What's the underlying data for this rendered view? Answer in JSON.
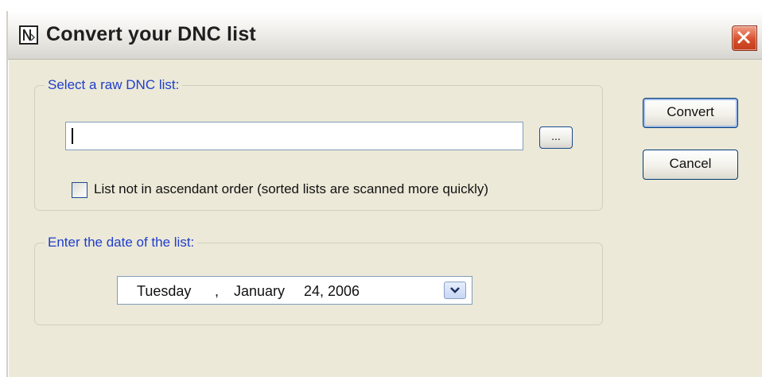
{
  "window": {
    "title": "Convert your DNC list",
    "icon": "dnc-file-icon",
    "close_icon": "close-icon"
  },
  "source_group": {
    "legend": "Select a raw DNC list:",
    "path_value": "",
    "browse_label": "...",
    "checkbox_checked": false,
    "checkbox_label": "List not in ascendant order (sorted lists are scanned more quickly)"
  },
  "date_group": {
    "legend": "Enter the date of the list:",
    "day_of_week": "Tuesday",
    "separator": ",",
    "month": "January",
    "date_year": "24, 2006",
    "dropdown_icon": "chevron-down-icon"
  },
  "actions": {
    "convert_label": "Convert",
    "cancel_label": "Cancel"
  },
  "colors": {
    "legend_text": "#1f3ecb",
    "close_button": "#d8502c",
    "dialog_bg": "#ece9d8"
  }
}
